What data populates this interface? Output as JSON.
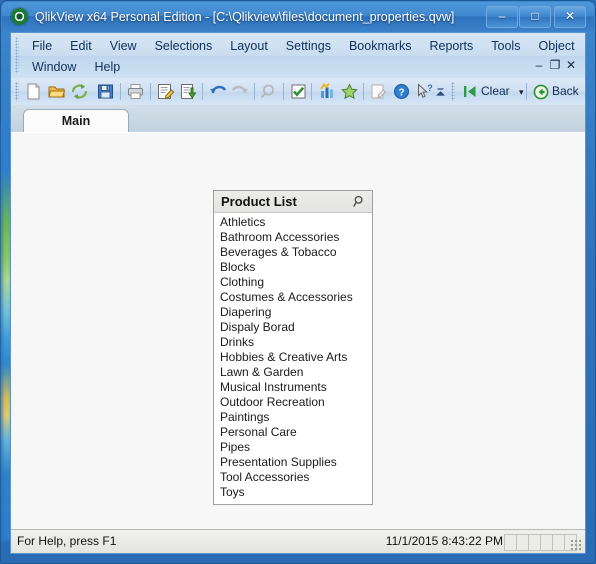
{
  "window": {
    "title": "QlikView x64 Personal Edition - [C:\\Qlikview\\files\\document_properties.qvw]",
    "app_icon": "qlikview-logo-icon",
    "controls": {
      "minimize": "–",
      "maximize": "□",
      "close": "✕"
    }
  },
  "menubar": {
    "items": [
      {
        "label": "File"
      },
      {
        "label": "Edit"
      },
      {
        "label": "View"
      },
      {
        "label": "Selections"
      },
      {
        "label": "Layout"
      },
      {
        "label": "Settings"
      },
      {
        "label": "Bookmarks"
      },
      {
        "label": "Reports"
      },
      {
        "label": "Tools"
      },
      {
        "label": "Object"
      },
      {
        "label": "Window"
      },
      {
        "label": "Help"
      }
    ],
    "mdi_controls": {
      "minimize": "–",
      "restore": "❐",
      "close": "✕"
    }
  },
  "toolbar": {
    "buttons": [
      {
        "name": "new-document-icon",
        "tip": "New"
      },
      {
        "name": "open-document-icon",
        "tip": "Open"
      },
      {
        "name": "reload-icon",
        "tip": "Reload"
      },
      {
        "name": "save-icon",
        "tip": "Save"
      },
      {
        "name": "print-icon",
        "tip": "Print"
      },
      {
        "name": "edit-script-icon",
        "tip": "Edit Script"
      },
      {
        "name": "reload-data-icon",
        "tip": "Reload Data"
      },
      {
        "name": "undo-icon",
        "tip": "Undo"
      },
      {
        "name": "redo-icon",
        "tip": "Redo"
      },
      {
        "name": "search-icon",
        "tip": "Search"
      },
      {
        "name": "current-selections-icon",
        "tip": "Current Selections"
      },
      {
        "name": "chart-icon",
        "tip": "Quick Chart"
      },
      {
        "name": "bookmark-star-icon",
        "tip": "Bookmarks"
      },
      {
        "name": "edit-module-icon",
        "tip": "Edit Module"
      },
      {
        "name": "help-icon",
        "tip": "Help"
      },
      {
        "name": "context-help-icon",
        "tip": "Context Help"
      }
    ],
    "clear_label": "Clear",
    "clear_icon": "clear-selections-icon",
    "back_label": "Back",
    "back_icon": "back-arrow-icon",
    "overflow_icon": "toolbar-overflow-icon"
  },
  "tabs": [
    {
      "label": "Main",
      "active": true
    }
  ],
  "listbox": {
    "title": "Product List",
    "search_icon": "search-icon",
    "items": [
      "Athletics",
      "Bathroom Accessories",
      "Beverages & Tobacco",
      "Blocks",
      "Clothing",
      "Costumes & Accessories",
      "Diapering",
      "Dispaly Borad",
      "Drinks",
      "Hobbies & Creative Arts",
      "Lawn & Garden",
      "Musical Instruments",
      "Outdoor Recreation",
      "Paintings",
      "Personal Care",
      "Pipes",
      "Presentation Supplies",
      "Tool Accessories",
      "Toys"
    ]
  },
  "statusbar": {
    "help_text": "For Help, press F1",
    "datetime": "11/1/2015 8:43:22 PM",
    "panel_count": 6,
    "grip": "resize-grip-icon"
  },
  "colors": {
    "titlebar": "#3f88cf",
    "menubar": "#c9ddf0",
    "canvas": "#f7f7f7",
    "listbox_caption": "#e6e6e5",
    "accent_green": "#2d8a3e"
  }
}
